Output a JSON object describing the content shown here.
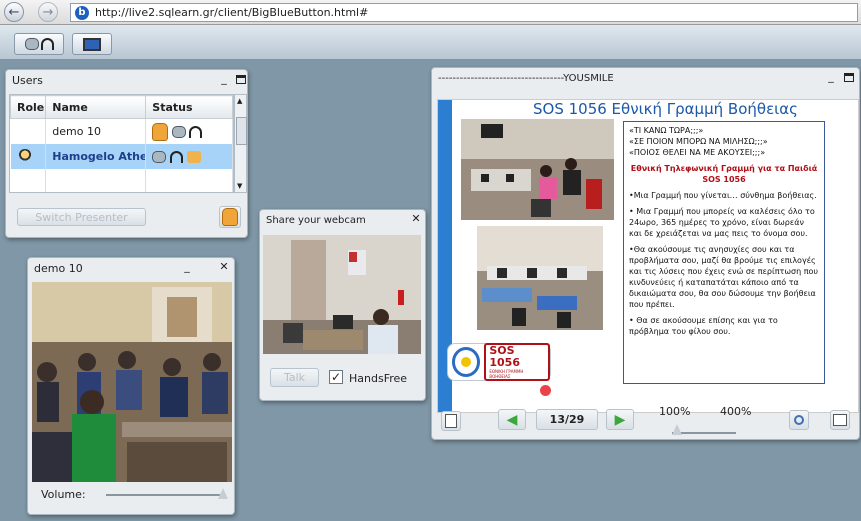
{
  "browser": {
    "back_icon": "back-arrow-icon",
    "forward_icon": "forward-arrow-icon",
    "favicon_letter": "b",
    "url": "http://live2.sqlearn.gr/client/BigBlueButton.html#"
  },
  "users_panel": {
    "title": "Users",
    "columns": [
      "Role",
      "Name",
      "Status"
    ],
    "rows": [
      {
        "name": "demo 10"
      },
      {
        "name": "Hamogelo Athens"
      }
    ],
    "switch_presenter": "Switch Presenter"
  },
  "video_panel": {
    "title": "demo 10",
    "volume_label": "Volume:"
  },
  "webcam_panel": {
    "title": "Share your webcam",
    "talk_label": "Talk",
    "handsfree_label": "HandsFree",
    "handsfree_checked": true
  },
  "presentation": {
    "title": "-----------------------------------YOUSMILE",
    "slide": {
      "heading": "SOS 1056 Εθνική Γραμμή Βοήθειας",
      "intro_lines": [
        "«ΤΙ ΚΑΝΩ ΤΩΡΑ;;;»",
        "«ΣΕ ΠΟΙΟΝ ΜΠΟΡΩ ΝΑ ΜΙΛΗΣΩ;;;»",
        "«ΠΟΙΟΣ ΘΕΛΕΙ ΝΑ ΜΕ ΑΚΟΥΣΕΙ;;;»"
      ],
      "red_title": "Εθνική Τηλεφωνική Γραμμή για τα Παιδιά SOS 1056",
      "p1": "•Μια Γραμμή που γίνεται… σύνθημα βοήθειας.",
      "p2": "• Μια Γραμμή που μπορείς να καλέσεις όλο το 24ωρο, 365 ημέρες το χρόνο, είναι δωρεάν και δε χρειάζεται να μας πεις το όνομα σου.",
      "p3": "•Θα ακούσουμε τις ανησυχίες σου και τα προβλήματα σου, μαζί θα βρούμε τις επιλογές και τις λύσεις που έχεις ενώ σε περίπτωση που κινδυνεύεις ή καταπατάται κάποιο από τα δικαιώματα σου, θα σου δώσουμε την βοήθεια που πρέπει.",
      "p4": "• Θα σε ακούσουμε επίσης και για το πρόβλημα του φίλου σου.",
      "logo_text": "SOS 1056",
      "logo_sub": "ΕΘΝΙΚΗ ΓΡΑΜΜΗ ΒΟΗΘΕΙΑΣ"
    },
    "page_indicator": "13/29",
    "zoom_min": "100%",
    "zoom_max": "400%",
    "zoom_level_fraction": 0.0
  },
  "colors": {
    "workspace": "#7f97a6",
    "selected_row": "#a6d3f7",
    "slide_heading": "#1b58a8",
    "slide_red": "#b01018",
    "nav_green": "#3aa83a"
  }
}
